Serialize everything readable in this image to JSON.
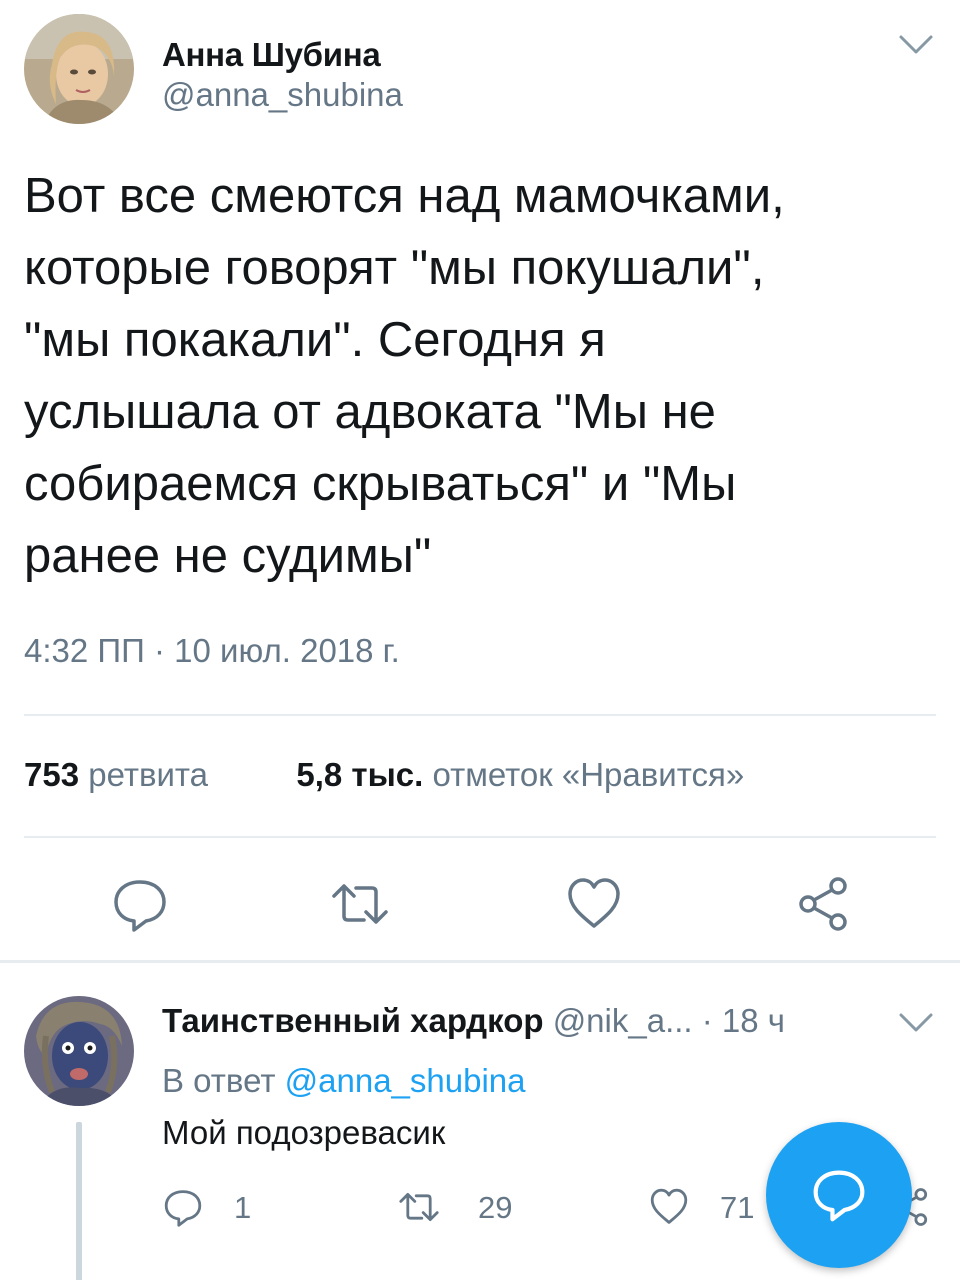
{
  "tweet": {
    "author_name": "Анна Шубина",
    "author_handle": "@anna_shubina",
    "text_lines": [
      "Вот все смеются над мамочками,",
      "которые говорят \"мы покушали\",",
      "\"мы покакали\". Сегодня я",
      "услышала от адвоката \"Мы не",
      "собираемся скрываться\" и \"Мы",
      "ранее не судимы\""
    ],
    "timestamp": "4:32 ПП · 10 июл. 2018 г.",
    "retweet_count": "753",
    "retweet_label": "ретвита",
    "like_count": "5,8 тыс.",
    "like_label": "отметок «Нравится»"
  },
  "reply": {
    "author_name": "Таинственный хардкор",
    "author_handle": "@nik_a...",
    "time": "· 18 ч",
    "reply_to_label": "В ответ",
    "reply_to_handle": "@anna_shubina",
    "text": "Мой подозревасик",
    "reply_count": "1",
    "retweet_count": "29",
    "like_count": "71"
  },
  "colors": {
    "accent": "#1da1f2",
    "secondary_text": "#657786",
    "divider": "#e6ecf0"
  },
  "icons": {
    "caret": "chevron-down-icon",
    "reply": "speech-bubble-icon",
    "retweet": "retweet-icon",
    "like": "heart-icon",
    "share": "share-icon",
    "compose": "compose-reply-icon"
  }
}
